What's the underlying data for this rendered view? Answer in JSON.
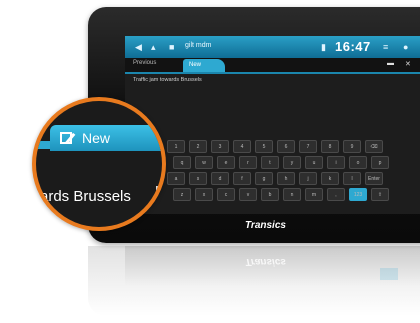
{
  "statusbar": {
    "time": "16:47",
    "app_name": "gilt mdm"
  },
  "tabs": {
    "previous": "Previous",
    "new_label": "New"
  },
  "message": {
    "preview": "Traffic jam towards Brussels"
  },
  "magnifier": {
    "tab_label": "New",
    "text": "ards Brussels"
  },
  "keyboard": {
    "rows": [
      [
        "1",
        "2",
        "3",
        "4",
        "5",
        "6",
        "7",
        "8",
        "9",
        "⌫"
      ],
      [
        "q",
        "w",
        "e",
        "r",
        "t",
        "y",
        "u",
        "i",
        "o",
        "p"
      ],
      [
        "a",
        "s",
        "d",
        "f",
        "g",
        "h",
        "j",
        "k",
        "l",
        "Enter"
      ],
      [
        "z",
        "x",
        "c",
        "v",
        "b",
        "n",
        "m",
        ",",
        "123",
        "⇧"
      ]
    ]
  },
  "device": {
    "brand": "Transics"
  },
  "colors": {
    "accent": "#2ea9d1",
    "orange": "#e87a1e"
  }
}
